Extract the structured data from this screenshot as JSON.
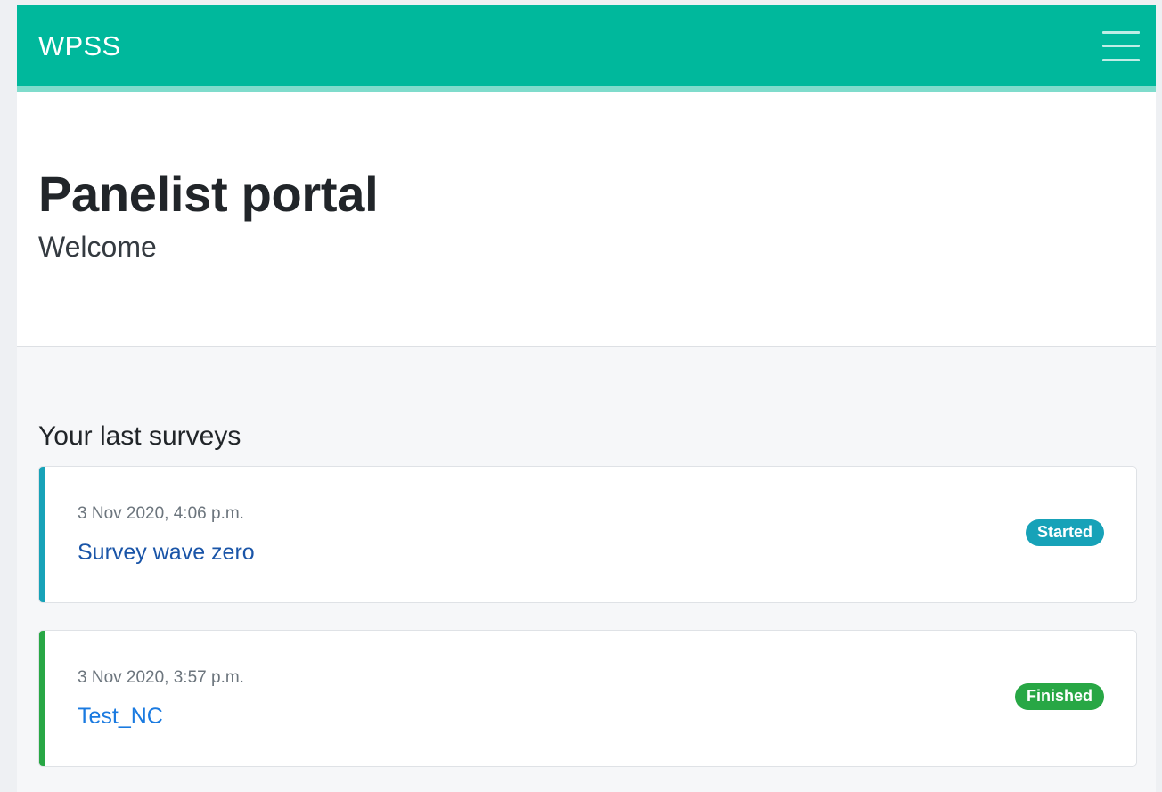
{
  "navbar": {
    "brand": "WPSS",
    "menu_icon": "hamburger-menu-icon",
    "background_color": "#00b89c"
  },
  "hero": {
    "title": "Panelist portal",
    "subtitle": "Welcome"
  },
  "surveys_section": {
    "title": "Your last surveys",
    "items": [
      {
        "date": "3 Nov 2020, 4:06 p.m.",
        "name": "Survey wave zero",
        "status": "Started",
        "accent_color": "#17a2b8",
        "link_color": "#1a55a8"
      },
      {
        "date": "3 Nov 2020, 3:57 p.m.",
        "name": "Test_NC",
        "status": "Finished",
        "accent_color": "#28a745",
        "link_color": "#1a7ae0"
      }
    ]
  }
}
